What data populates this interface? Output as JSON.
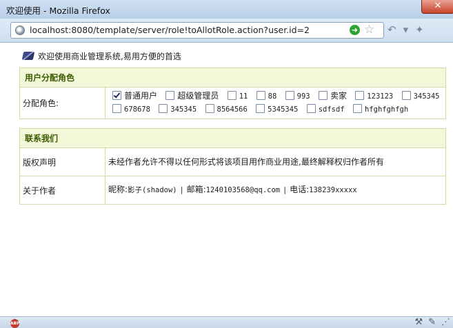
{
  "window": {
    "title": "欢迎使用 - Mozilla Firefox",
    "close": "✕"
  },
  "navbar": {
    "url": "localhost:8080/template/server/role!toAllotRole.action?user.id=2",
    "icons": [
      "site-icon",
      "go-icon",
      "bookmark-star-icon",
      "back-forward-icon",
      "dropdown-icon",
      "extension-icon"
    ]
  },
  "content": {
    "welcome": "欢迎使用商业管理系统,易用方便的首选",
    "role_section": {
      "title": "用户分配角色",
      "label": "分配角色:",
      "roles": [
        {
          "name": "普通用户",
          "checked": true
        },
        {
          "name": "超级管理员",
          "checked": false
        },
        {
          "name": "11",
          "checked": false
        },
        {
          "name": "88",
          "checked": false
        },
        {
          "name": "993",
          "checked": false
        },
        {
          "name": "卖家",
          "checked": false
        },
        {
          "name": "123123",
          "checked": false
        },
        {
          "name": "345345",
          "checked": false
        },
        {
          "name": "678678",
          "checked": false
        },
        {
          "name": "345345",
          "checked": false
        },
        {
          "name": "8564566",
          "checked": false
        },
        {
          "name": "5345345",
          "checked": false
        },
        {
          "name": "sdfsdf",
          "checked": false
        },
        {
          "name": "hfghfghfgh",
          "checked": false
        }
      ]
    },
    "contact_section": {
      "title": "联系我们",
      "copyright_label": "版权声明",
      "copyright_text": "未经作者允许不得以任何形式将该项目用作商业用途,最终解释权归作者所有",
      "author_label": "关于作者",
      "author_nick_label": "昵称:",
      "author_nick": "影子(shadow)",
      "sep": "|",
      "author_email_label": "邮箱:",
      "author_email": "1240103568@qq.com",
      "author_phone_label": "电话:",
      "author_phone": "138239xxxxx"
    }
  },
  "statusbar": {
    "abp": "ABP"
  },
  "colors": {
    "section_header_bg": "#f2f8d8",
    "section_header_text": "#3c5a00",
    "border": "#d6d8a8"
  }
}
